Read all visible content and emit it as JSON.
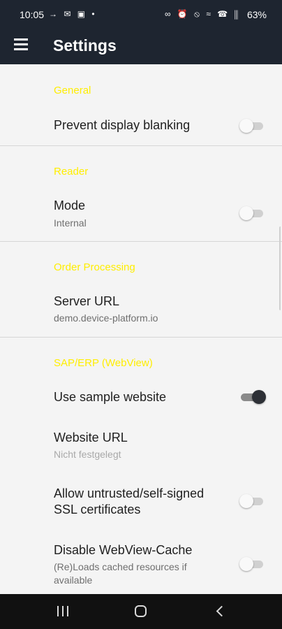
{
  "status_bar": {
    "time": "10:05",
    "left_icons": "→ ✉ ▣ •",
    "right_icons": "∞ ⏰ ⦸ ≈ ☎ ⫼",
    "battery": "63%"
  },
  "app_bar": {
    "title": "Settings",
    "menu_icon": "hamburger-menu-icon"
  },
  "sections": [
    {
      "header": "General",
      "items": [
        {
          "title": "Prevent display blanking",
          "switch": false
        }
      ]
    },
    {
      "header": "Reader",
      "items": [
        {
          "title": "Mode",
          "summary": "Internal",
          "switch": false
        }
      ]
    },
    {
      "header": "Order Processing",
      "items": [
        {
          "title": "Server URL",
          "summary": "demo.device-platform.io"
        }
      ]
    },
    {
      "header": "SAP/ERP (WebView)",
      "items": [
        {
          "title": "Use sample website",
          "switch": true
        },
        {
          "title": "Website URL",
          "summary": "Nicht festgelegt"
        },
        {
          "title_line1": "Allow untrusted/self-signed",
          "title_line2": "SSL certificates",
          "switch": false
        },
        {
          "title": "Disable WebView-Cache",
          "summary_line1": "(Re)Loads cached resources if",
          "summary_line2": "available",
          "switch": false
        }
      ]
    }
  ],
  "colors": {
    "app_bar": "#1e2530",
    "section_header": "#ffee00",
    "background": "#f4f4f4",
    "nav_bar": "#111111"
  },
  "nav_bar": {
    "icons": [
      "recent-apps-icon",
      "home-icon",
      "back-icon"
    ]
  }
}
